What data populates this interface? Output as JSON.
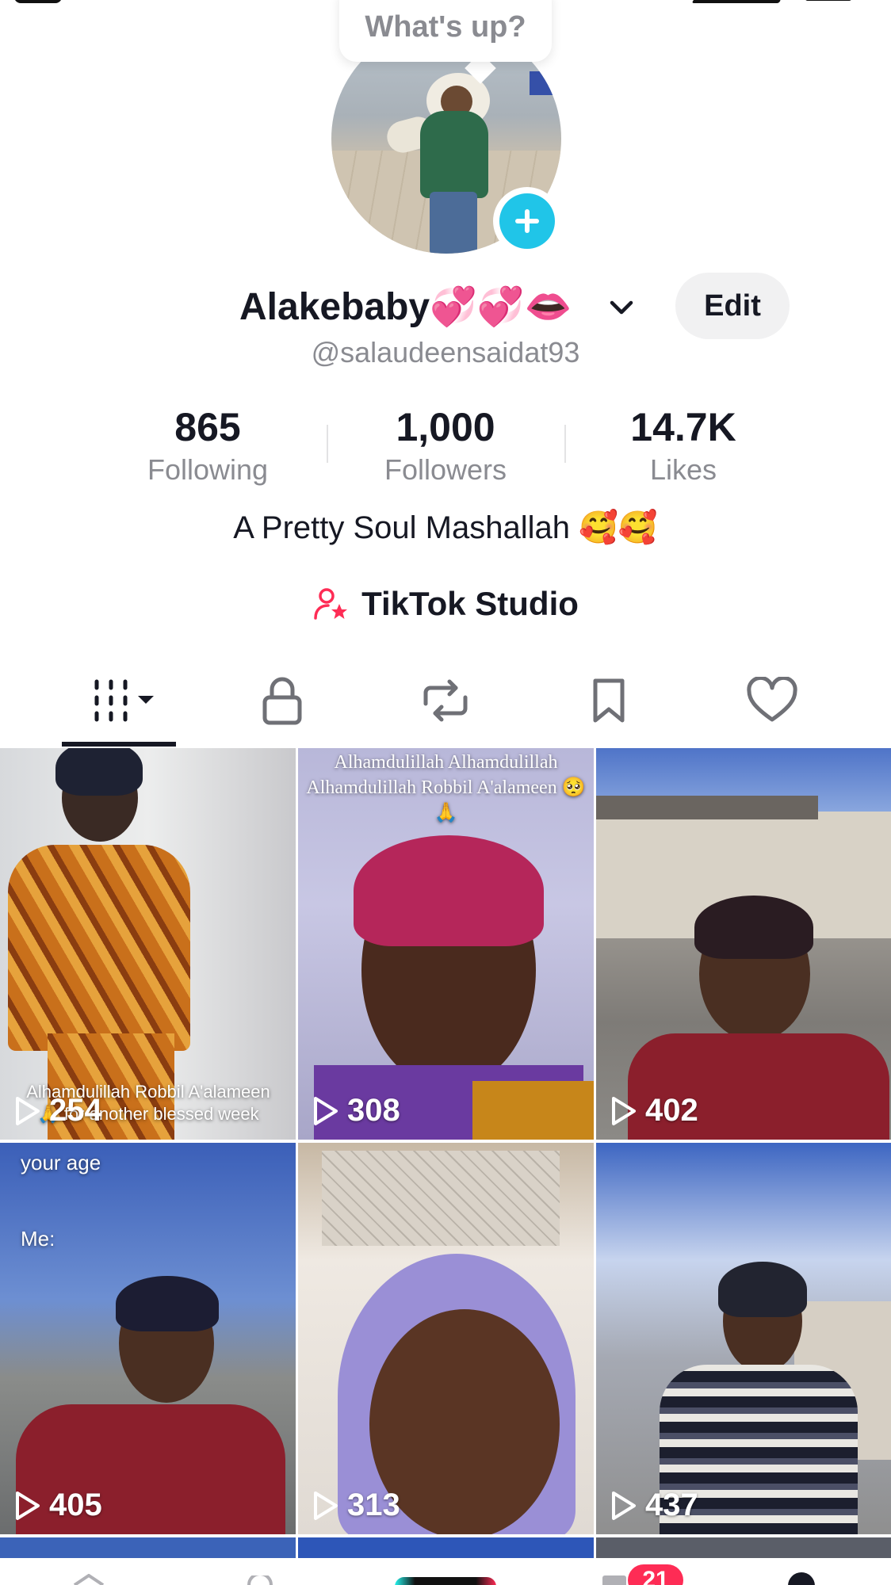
{
  "bubble": {
    "text": "What's up?"
  },
  "profile": {
    "display_name": "Alakebaby💞💞👄",
    "edit_label": "Edit",
    "handle": "@salaudeensaidat93",
    "bio": "A Pretty Soul Mashallah 🥰🥰",
    "studio_label": "TikTok Studio"
  },
  "stats": [
    {
      "value": "865",
      "label": "Following"
    },
    {
      "value": "1,000",
      "label": "Followers"
    },
    {
      "value": "14.7K",
      "label": "Likes"
    }
  ],
  "tabs": [
    {
      "icon": "grid-icon",
      "active": true
    },
    {
      "icon": "lock-icon",
      "active": false
    },
    {
      "icon": "repost-icon",
      "active": false
    },
    {
      "icon": "bookmark-icon",
      "active": false
    },
    {
      "icon": "heart-icon",
      "active": false
    }
  ],
  "videos": [
    {
      "views": "254",
      "caption": "Alhamdulillah Robbil A'alameen 🙏 for another blessed week"
    },
    {
      "views": "308",
      "caption": "Alhamdulillah Alhamdulillah Alhamdulillah Robbil A'alameen 🥺🙏"
    },
    {
      "views": "402",
      "caption": ""
    },
    {
      "views": "405",
      "caption_line1": "your age",
      "caption_line2": "Me:"
    },
    {
      "views": "313",
      "caption": ""
    },
    {
      "views": "437",
      "caption": ""
    }
  ],
  "nav": {
    "inbox_badge": "21"
  },
  "colors": {
    "accent": "#fe2c55",
    "add_button": "#20c5e8",
    "text": "#161823",
    "muted": "#8a8b91"
  }
}
